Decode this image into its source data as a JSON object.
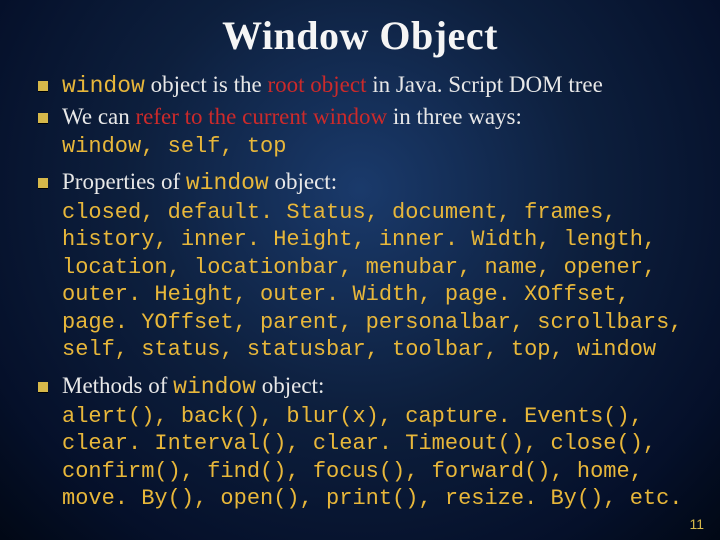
{
  "title": "Window Object",
  "bullets": {
    "b1": {
      "code1": "window",
      "t1": " object is the ",
      "hot1": "root object",
      "t2": " in Java. Script DOM tree"
    },
    "b2": {
      "t1": "We can ",
      "hot1": "refer to the current window",
      "t2": " in three ways:",
      "sub": "window, self, top"
    },
    "b3": {
      "t1": "Properties of ",
      "code1": "window",
      "t2": " object:",
      "sub": "closed, default. Status, document, frames, history, inner. Height, inner. Width, length, location, locationbar, menubar, name, opener, outer. Height, outer. Width, page. XOffset, page. YOffset, parent, personalbar, scrollbars, self, status, statusbar, toolbar, top, window"
    },
    "b4": {
      "t1": "Methods of ",
      "code1": "window",
      "t2": " object:",
      "sub": "alert(), back(), blur(x), capture. Events(), clear. Interval(), clear. Timeout(), close(), confirm(), find(), focus(), forward(), home, move. By(), open(), print(), resize. By(), etc."
    }
  },
  "page_number": "11"
}
